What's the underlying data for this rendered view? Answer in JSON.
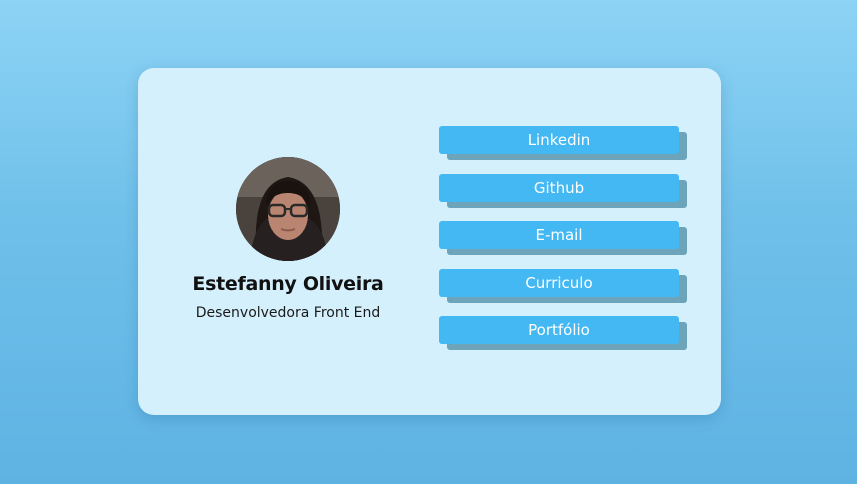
{
  "profile": {
    "name": "Estefanny Oliveira",
    "role": "Desenvolvedora Front End",
    "avatar_icon": "profile-photo"
  },
  "links": [
    {
      "label": "Linkedin"
    },
    {
      "label": "Github"
    },
    {
      "label": "E-mail"
    },
    {
      "label": "Curriculo"
    },
    {
      "label": "Portfólio"
    }
  ],
  "colors": {
    "background_top": "#8dd3f5",
    "background_bottom": "#5eb3e3",
    "card": "#d5f0fd",
    "button": "#43b8f3",
    "button_shadow": "#6da4b9",
    "button_text": "#ffffff"
  }
}
